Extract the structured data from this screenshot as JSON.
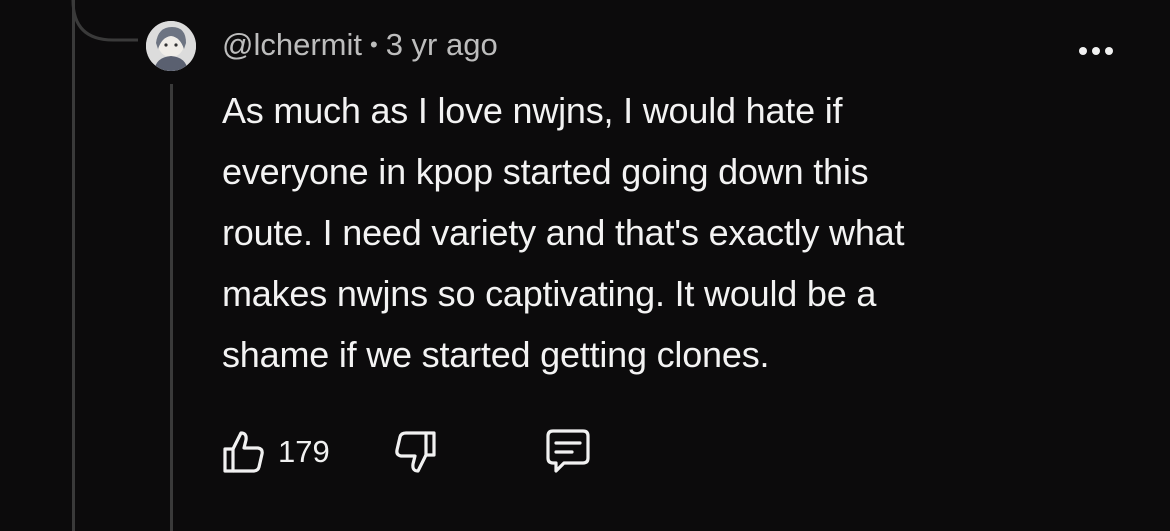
{
  "comment": {
    "author": "@lchermit",
    "separator": "•",
    "timestamp": "3 yr ago",
    "lines": [
      "As much as I love nwjns, I would hate if",
      "everyone in kpop started going down this",
      "route. I need variety and that's exactly what",
      "makes nwjns so captivating. It would be a",
      "shame if we started getting clones."
    ],
    "like_count": "179"
  },
  "icons": {
    "avatar": "avatar-image",
    "more": "more-vertical-dots-icon",
    "like": "thumbs-up-icon",
    "dislike": "thumbs-down-icon",
    "reply": "reply-comment-icon"
  }
}
